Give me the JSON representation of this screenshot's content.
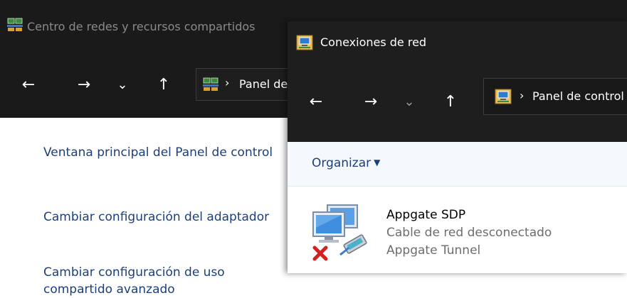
{
  "background_window": {
    "title": "Centro de redes y recursos compartidos",
    "nav": {
      "back": "←",
      "forward": "→",
      "recent": "⌄",
      "up": "↑"
    },
    "address": {
      "separator": "›",
      "text": "Panel de control"
    },
    "left_pane": {
      "links": [
        "Ventana principal del Panel de control",
        "Cambiar configuración del adaptador",
        "Cambiar configuración de uso compartido avanzado"
      ]
    }
  },
  "foreground_window": {
    "title": "Conexiones de red",
    "nav": {
      "back": "←",
      "forward": "→",
      "recent": "⌄",
      "up": "↑"
    },
    "address": {
      "separator": "›",
      "text": "Panel de control"
    },
    "toolbar": {
      "organize_label": "Organizar",
      "organize_caret": "▼"
    },
    "connections": [
      {
        "name": "Appgate SDP",
        "status": "Cable de red desconectado",
        "device": "Appgate Tunnel"
      }
    ]
  },
  "colors": {
    "titlebar_dark": "#1a1a1a",
    "link_blue": "#1c3f7a",
    "toolbar_bg": "#f5f8fc",
    "status_gray": "#6d6d6d",
    "error_red": "#d42020"
  },
  "icons": {
    "window": "network-center-icon",
    "connections": "network-connections-icon",
    "adapter": "network-adapter-disconnected-icon"
  }
}
